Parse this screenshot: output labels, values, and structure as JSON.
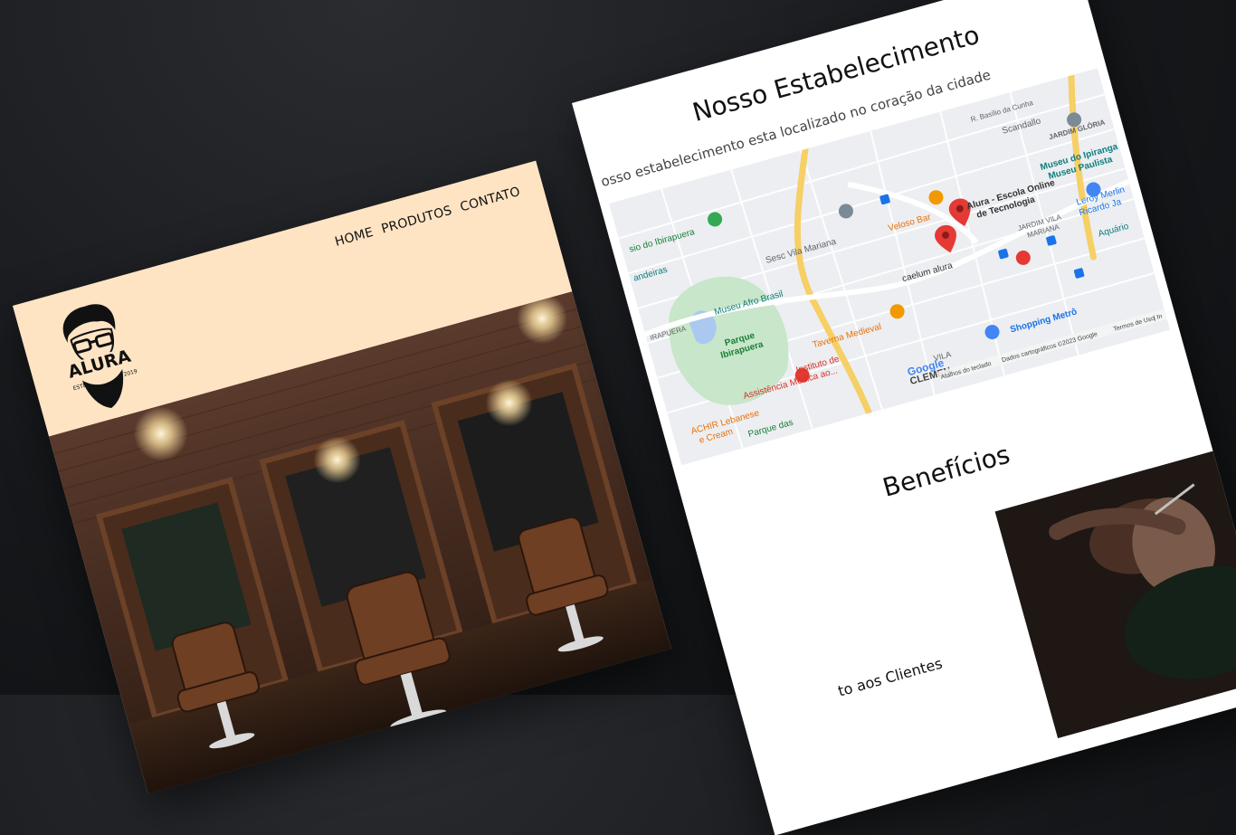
{
  "left_page": {
    "logo": {
      "brand": "ALURA",
      "est_label": "ESTD",
      "year": "2019"
    },
    "nav": [
      {
        "label": "HOME"
      },
      {
        "label": "PRODUTOS"
      },
      {
        "label": "CONTATO"
      }
    ]
  },
  "right_page": {
    "section_title": "Nosso Estabelecimento",
    "section_subtitle": "osso estabelecimento esta localizado no coração da cidade",
    "map": {
      "places": [
        {
          "label": "R. Basílio da Cunha"
        },
        {
          "label": "Scandallo"
        },
        {
          "label": "JARDIM GLÓRIA"
        },
        {
          "label": "sio do Ibirapuera"
        },
        {
          "label": "Museu do Ipiranga"
        },
        {
          "label": "Museu Paulista"
        },
        {
          "label": "andeiras"
        },
        {
          "label": "Sesc Vila Mariana"
        },
        {
          "label": "Veloso Bar"
        },
        {
          "label": "Alura - Escola Online"
        },
        {
          "label": "de Tecnologia"
        },
        {
          "label": "Leroy Merlin"
        },
        {
          "label": "Ricardo Ja"
        },
        {
          "label": "Museu Afro Brasil"
        },
        {
          "label": "Aquário"
        },
        {
          "label": "IRAPUERA"
        },
        {
          "label": "caelum alura"
        },
        {
          "label": "JARDIM VILA"
        },
        {
          "label": "MARIANA"
        },
        {
          "label": "Parque"
        },
        {
          "label": "Ibirapuera"
        },
        {
          "label": "Taverna Medieval"
        },
        {
          "label": "Instituto de"
        },
        {
          "label": "Assistência Médica ao..."
        },
        {
          "label": "Shopping Metrô"
        },
        {
          "label": "ACHIR Lebanese"
        },
        {
          "label": "e Cream"
        },
        {
          "label": "Parque das"
        },
        {
          "label": "VILA"
        },
        {
          "label": "CLEMEN"
        }
      ],
      "brand": "Google",
      "footer": {
        "shortcuts": "Atalhos do teclado",
        "data": "Dados cartográficos ©2023 Google",
        "terms": "Termos de Uso",
        "report": "| In"
      }
    },
    "benefits_title": "Benefícios",
    "benefit_item": "to aos Clientes"
  },
  "colors": {
    "page_background": "#16181b",
    "header_bg": "#ffe4c4",
    "road_yellow": "#f6cf65",
    "park_green": "#c8e6c9",
    "pin_red": "#e53935",
    "pin_orange": "#f29900",
    "pin_green": "#34a853",
    "transit_blue": "#1a73e8"
  }
}
